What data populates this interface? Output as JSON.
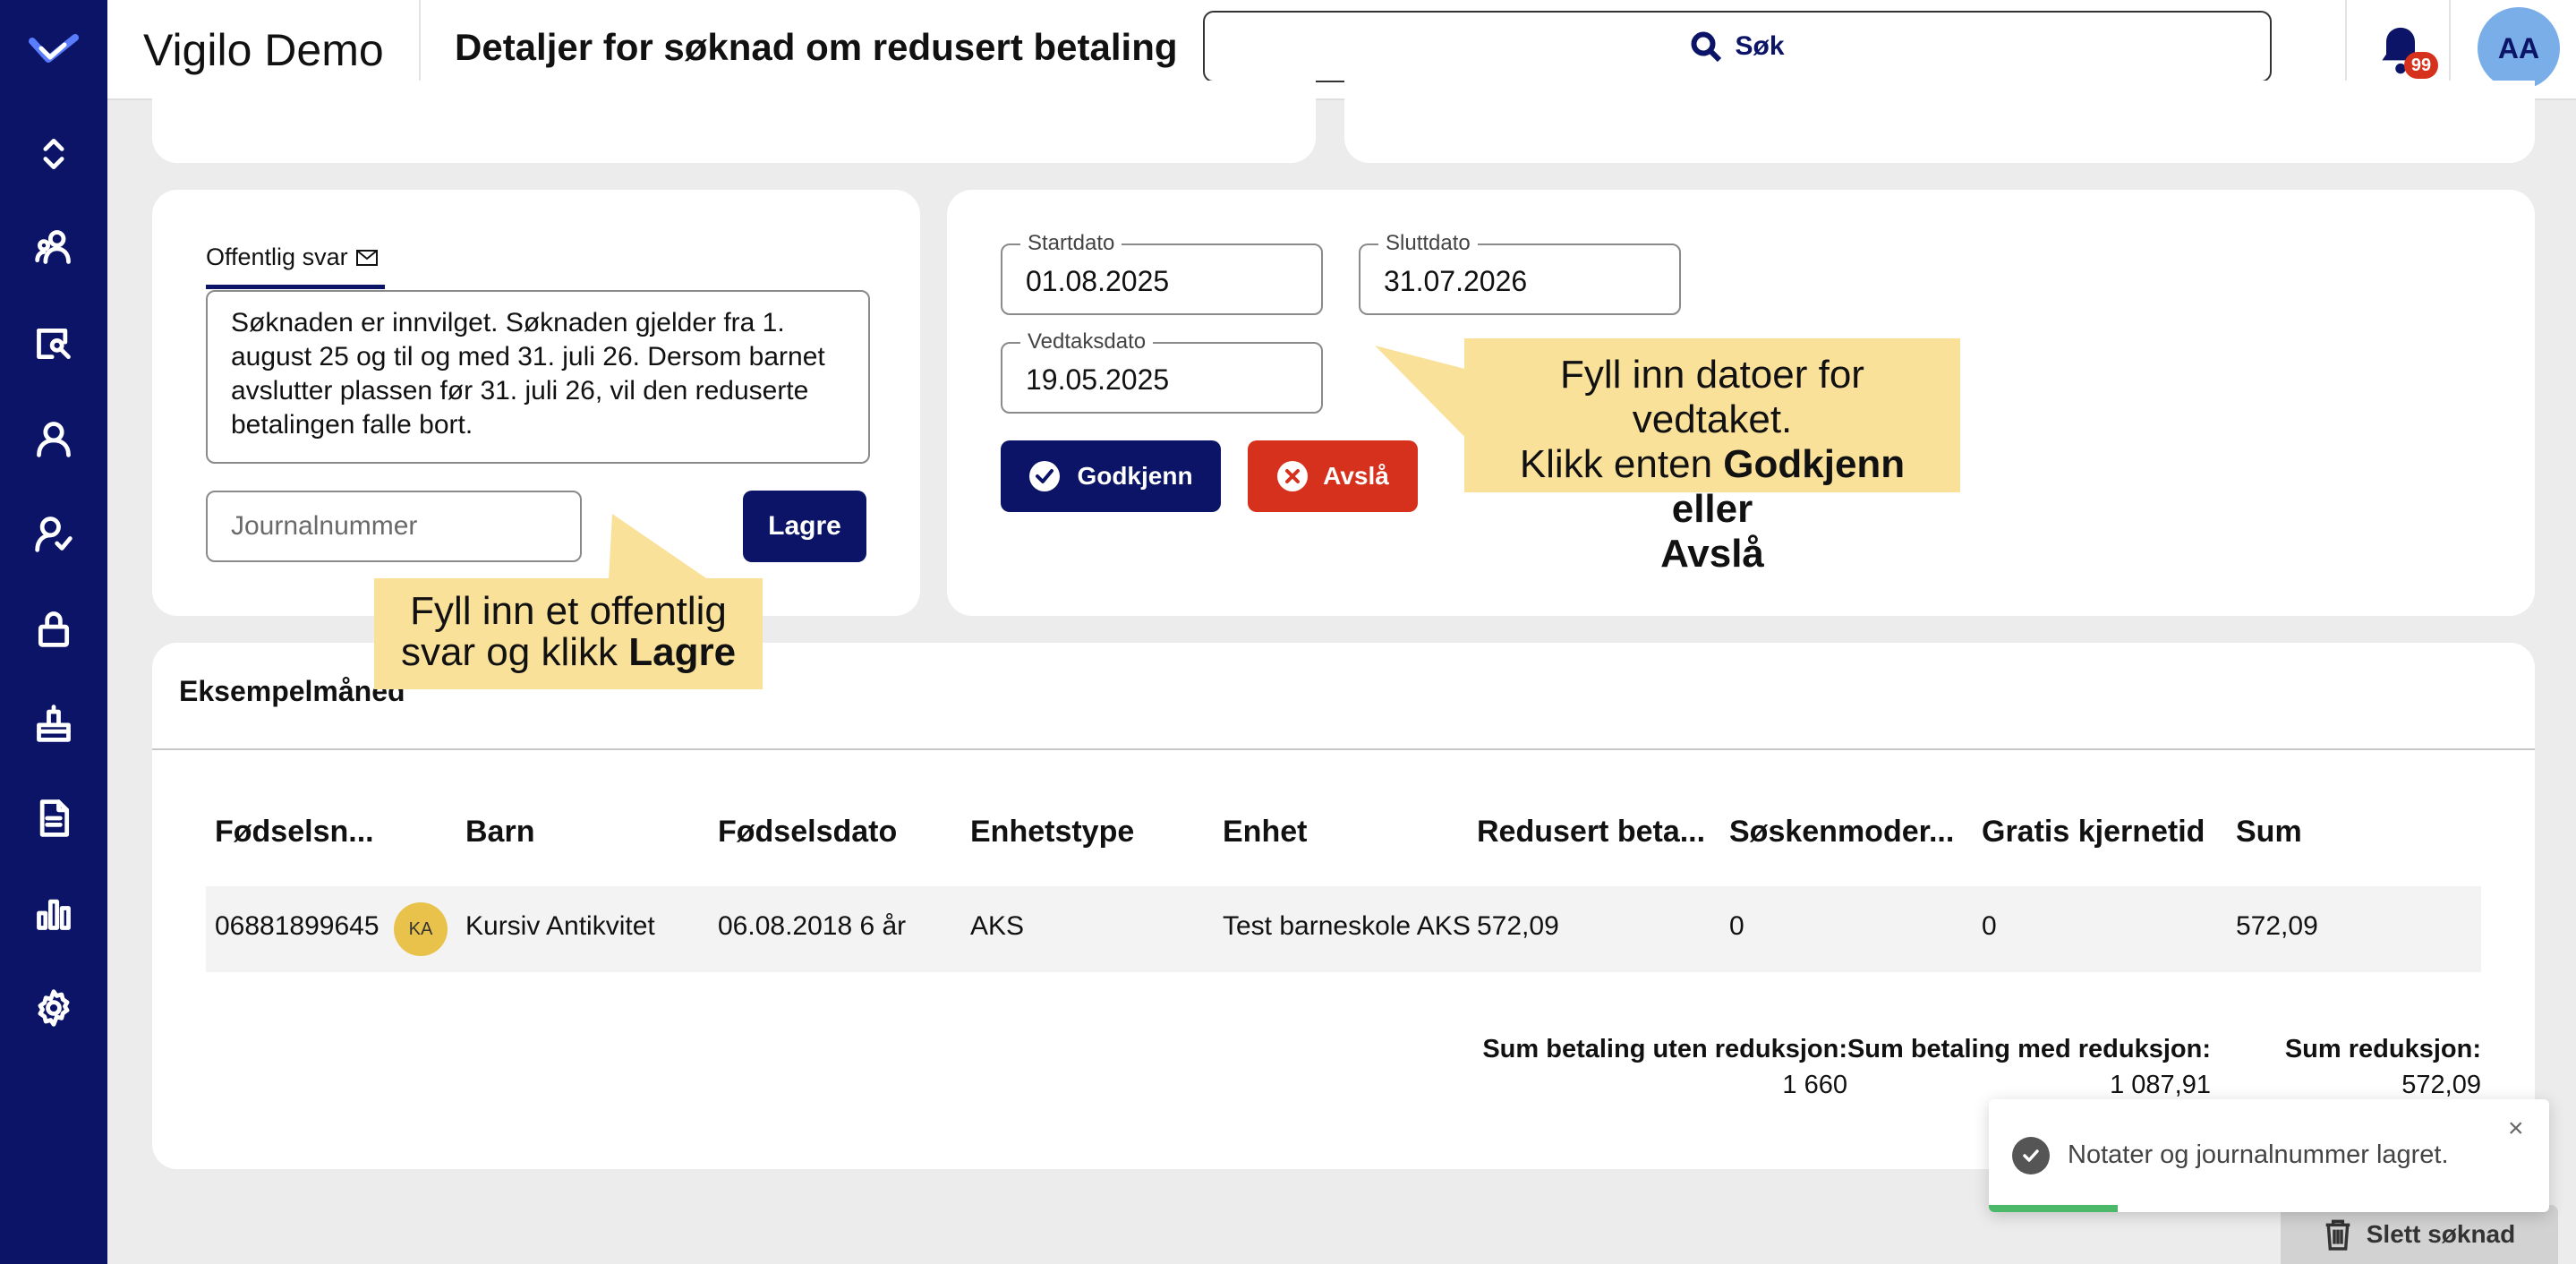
{
  "header": {
    "app_title": "Vigilo Demo",
    "page_title": "Detaljer for søknad om redusert betaling",
    "search_label": "Søk",
    "notification_count": "99",
    "avatar_initials": "AA"
  },
  "sidebar": {
    "icons": [
      "collapse-icon",
      "people-icon",
      "search-person-icon",
      "person-icon",
      "person-check-icon",
      "lock-icon",
      "inbox-icon",
      "document-icon",
      "bar-chart-icon",
      "gear-icon"
    ]
  },
  "reply_panel": {
    "tab_label": "Offentlig svar",
    "reply_text": "Søknaden er innvilget. Søknaden gjelder fra 1. august 25 og til og med 31. juli 26. Dersom barnet avslutter plassen før 31. juli 26, vil den reduserte betalingen falle bort.",
    "journal_placeholder": "Journalnummer",
    "save_label": "Lagre"
  },
  "decision_panel": {
    "start_label": "Startdato",
    "start_value": "01.08.2025",
    "end_label": "Sluttdato",
    "end_value": "31.07.2026",
    "decision_label": "Vedtaksdato",
    "decision_value": "19.05.2025",
    "approve_label": "Godkjenn",
    "reject_label": "Avslå"
  },
  "tooltips": {
    "dates_line1": "Fyll inn datoer for vedtaket.",
    "dates_line2_plain": "Klikk enten ",
    "dates_line2_bold": "Godkjenn eller",
    "dates_line3_bold": "Avslå",
    "reply_line1": "Fyll inn et offentlig",
    "reply_line2_plain": "svar og klikk ",
    "reply_line2_bold": "Lagre"
  },
  "example_month": {
    "title": "Eksempelmåned",
    "columns": [
      "Fødselsn...",
      "Barn",
      "Fødselsdato",
      "Enhetstype",
      "Enhet",
      "Redusert beta...",
      "Søskenmoder...",
      "Gratis kjernetid",
      "Sum"
    ],
    "row": {
      "birth_number": "06881899645",
      "avatar_initials": "KA",
      "child": "Kursiv Antikvitet",
      "birth_date": "06.08.2018 6 år",
      "unit_type": "AKS",
      "unit": "Test barneskole AKS",
      "reduced": "572,09",
      "sibling": "0",
      "free_core": "0",
      "sum": "572,09"
    },
    "totals": {
      "without_label": "Sum betaling uten reduksjon:",
      "without_value": "1 660",
      "with_label": "Sum betaling med reduksjon:",
      "with_value": "1 087,91",
      "reduction_label": "Sum reduksjon:",
      "reduction_value": "572,09"
    }
  },
  "toast": {
    "message": "Notater og journalnummer lagret.",
    "close": "×",
    "progress": 0.23
  },
  "delete_label": "Slett søknad",
  "colors": {
    "brand": "#0b1466",
    "danger": "#d6311d",
    "tooltip": "#fae19a",
    "success": "#4cb86a"
  }
}
